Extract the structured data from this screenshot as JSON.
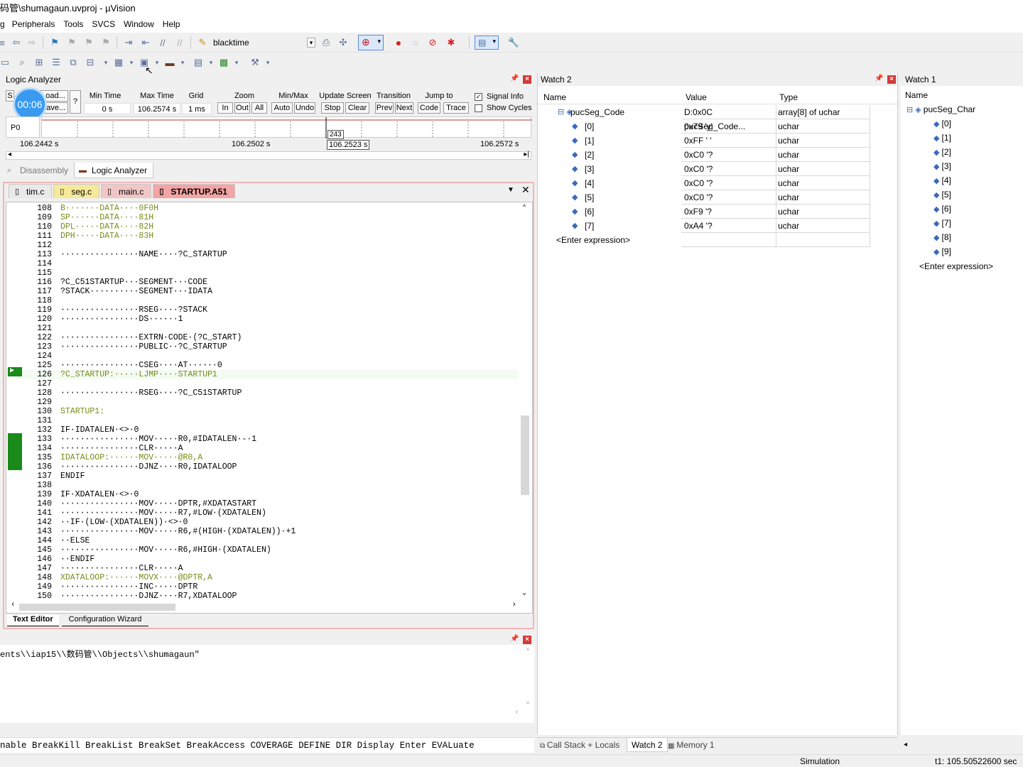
{
  "title": "码管\\shumagaun.uvproj - µVision",
  "menu": [
    "Peripherals",
    "Tools",
    "SVCS",
    "Window",
    "Help"
  ],
  "toolbar": {
    "combo_value": "blacktime"
  },
  "timer_badge": "00:06",
  "logic_analyzer": {
    "title": "Logic Analyzer",
    "setup_label": "S",
    "load_label": "Load...",
    "save_label": "Save...",
    "help_label": "?",
    "min_time_label": "Min Time",
    "min_time": "0 s",
    "max_time_label": "Max Time",
    "max_time": "106.2574 s",
    "grid_label": "Grid",
    "grid": "1 ms",
    "zoom_label": "Zoom",
    "zoom_in": "In",
    "zoom_out": "Out",
    "zoom_all": "All",
    "minmax_label": "Min/Max",
    "auto": "Auto",
    "undo": "Undo",
    "update_label": "Update Screen",
    "stop": "Stop",
    "clear": "Clear",
    "transition_label": "Transition",
    "prev": "Prev",
    "next": "Next",
    "jumpto_label": "Jump to",
    "code": "Code",
    "trace": "Trace",
    "signal_info": "Signal Info",
    "show_cycles": "Show Cycles",
    "signal": "P0",
    "cursor_value": "243",
    "t_left": "106.2442  s",
    "t_mid": "106.2502  s",
    "t_cursor": "106.2523  s",
    "t_right": "106.2572  s"
  },
  "view_tabs": [
    "Disassembly",
    "Logic Analyzer"
  ],
  "file_tabs": [
    "tim.c",
    "seg.c",
    "main.c",
    "STARTUP.A51"
  ],
  "code_lines": [
    {
      "n": "108",
      "t": "B·······DATA····0F0H"
    },
    {
      "n": "109",
      "t": "SP······DATA····81H"
    },
    {
      "n": "110",
      "t": "DPL·····DATA····82H"
    },
    {
      "n": "111",
      "t": "DPH·····DATA····83H"
    },
    {
      "n": "112",
      "t": ""
    },
    {
      "n": "113",
      "t": "················NAME····?C_STARTUP"
    },
    {
      "n": "114",
      "t": ""
    },
    {
      "n": "115",
      "t": ""
    },
    {
      "n": "116",
      "t": "?C_C51STARTUP···SEGMENT···CODE"
    },
    {
      "n": "117",
      "t": "?STACK··········SEGMENT···IDATA"
    },
    {
      "n": "118",
      "t": ""
    },
    {
      "n": "119",
      "t": "················RSEG····?STACK"
    },
    {
      "n": "120",
      "t": "················DS······1"
    },
    {
      "n": "121",
      "t": ""
    },
    {
      "n": "122",
      "t": "················EXTRN·CODE·(?C_START)"
    },
    {
      "n": "123",
      "t": "················PUBLIC··?C_STARTUP"
    },
    {
      "n": "124",
      "t": ""
    },
    {
      "n": "125",
      "t": "················CSEG····AT······0"
    },
    {
      "n": "126",
      "t": "?C_STARTUP:·····LJMP····STARTUP1"
    },
    {
      "n": "127",
      "t": ""
    },
    {
      "n": "128",
      "t": "················RSEG····?C_C51STARTUP"
    },
    {
      "n": "129",
      "t": ""
    },
    {
      "n": "130",
      "t": "STARTUP1:"
    },
    {
      "n": "131",
      "t": ""
    },
    {
      "n": "132",
      "t": "IF·IDATALEN·<>·0"
    },
    {
      "n": "133",
      "t": "················MOV·····R0,#IDATALEN·-·1"
    },
    {
      "n": "134",
      "t": "················CLR·····A"
    },
    {
      "n": "135",
      "t": "IDATALOOP:······MOV·····@R0,A"
    },
    {
      "n": "136",
      "t": "················DJNZ····R0,IDATALOOP"
    },
    {
      "n": "137",
      "t": "ENDIF"
    },
    {
      "n": "138",
      "t": ""
    },
    {
      "n": "139",
      "t": "IF·XDATALEN·<>·0"
    },
    {
      "n": "140",
      "t": "················MOV·····DPTR,#XDATASTART"
    },
    {
      "n": "141",
      "t": "················MOV·····R7,#LOW·(XDATALEN)"
    },
    {
      "n": "142",
      "t": "··IF·(LOW·(XDATALEN))·<>·0"
    },
    {
      "n": "143",
      "t": "················MOV·····R6,#(HIGH·(XDATALEN))·+1"
    },
    {
      "n": "144",
      "t": "··ELSE"
    },
    {
      "n": "145",
      "t": "················MOV·····R6,#HIGH·(XDATALEN)"
    },
    {
      "n": "146",
      "t": "··ENDIF"
    },
    {
      "n": "147",
      "t": "················CLR·····A"
    },
    {
      "n": "148",
      "t": "XDATALOOP:······MOVX····@DPTR,A"
    },
    {
      "n": "149",
      "t": "················INC·····DPTR"
    },
    {
      "n": "150",
      "t": "················DJNZ····R7,XDATALOOP"
    }
  ],
  "editor_tabs": [
    "Text Editor",
    "Configuration Wizard"
  ],
  "command_output": "ents\\\\iap15\\\\数码管\\\\Objects\\\\shumagaun\"",
  "command_help": "nable BreakKill BreakList BreakSet BreakAccess COVERAGE DEFINE DIR Display Enter EVALuate",
  "watch2": {
    "title": "Watch 2",
    "col_name": "Name",
    "col_value": "Value",
    "col_type": "Type",
    "root": {
      "name": "pucSeg_Code",
      "value": "D:0x0C pucSeg_Code...",
      "type": "array[8] of uchar"
    },
    "items": [
      {
        "name": "[0]",
        "value": "0x79 'y'",
        "type": "uchar"
      },
      {
        "name": "[1]",
        "value": "0xFF '  '",
        "type": "uchar"
      },
      {
        "name": "[2]",
        "value": "0xC0 '?",
        "type": "uchar"
      },
      {
        "name": "[3]",
        "value": "0xC0 '?",
        "type": "uchar"
      },
      {
        "name": "[4]",
        "value": "0xC0 '?",
        "type": "uchar"
      },
      {
        "name": "[5]",
        "value": "0xC0 '?",
        "type": "uchar"
      },
      {
        "name": "[6]",
        "value": "0xF9 '?",
        "type": "uchar"
      },
      {
        "name": "[7]",
        "value": "0xA4 '?",
        "type": "uchar"
      }
    ],
    "enter": "<Enter expression>"
  },
  "watch1": {
    "title": "Watch 1",
    "col_name": "Name",
    "root": "pucSeg_Char",
    "items": [
      "[0]",
      "[1]",
      "[2]",
      "[3]",
      "[4]",
      "[5]",
      "[6]",
      "[7]",
      "[8]",
      "[9]"
    ],
    "enter": "<Enter expression>"
  },
  "bottom_tabs": [
    "Call Stack + Locals",
    "Watch 2",
    "Memory 1"
  ],
  "status": {
    "mode": "Simulation",
    "time": "t1: 105.50522600 sec"
  }
}
